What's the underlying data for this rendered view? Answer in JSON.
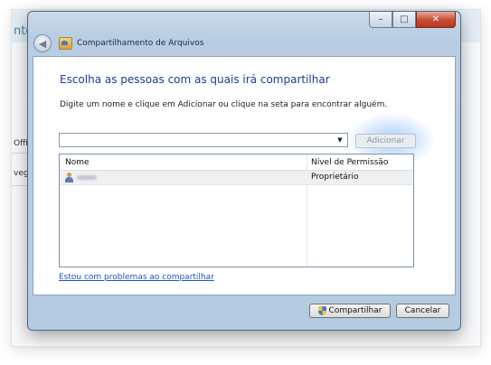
{
  "background": {
    "fragments": [
      "ntos",
      "Offi",
      "vegan"
    ]
  },
  "window": {
    "title": "Compartilhamento de Arquivos",
    "controls": {
      "minimize": "–",
      "maximize": "□",
      "close": "✕"
    }
  },
  "main": {
    "heading": "Escolha as pessoas com as quais irá compartilhar",
    "instruction": "Digite um nome e clique em Adicionar ou clique na seta para encontrar alguém.",
    "name_input": {
      "value": "",
      "placeholder": ""
    },
    "add_label": "Adicionar",
    "table": {
      "columns": [
        "Nome",
        "Nível de Permissão"
      ],
      "rows": [
        {
          "name": "",
          "permission": "Proprietário"
        }
      ]
    },
    "help_link": "Estou com problemas ao compartilhar"
  },
  "footer": {
    "share_label": "Compartilhar",
    "cancel_label": "Cancelar"
  },
  "icons": {
    "back": "back-arrow-icon",
    "title": "share-folder-icon",
    "user": "user-icon",
    "shield": "uac-shield-icon",
    "dropdown": "chevron-down-icon"
  }
}
